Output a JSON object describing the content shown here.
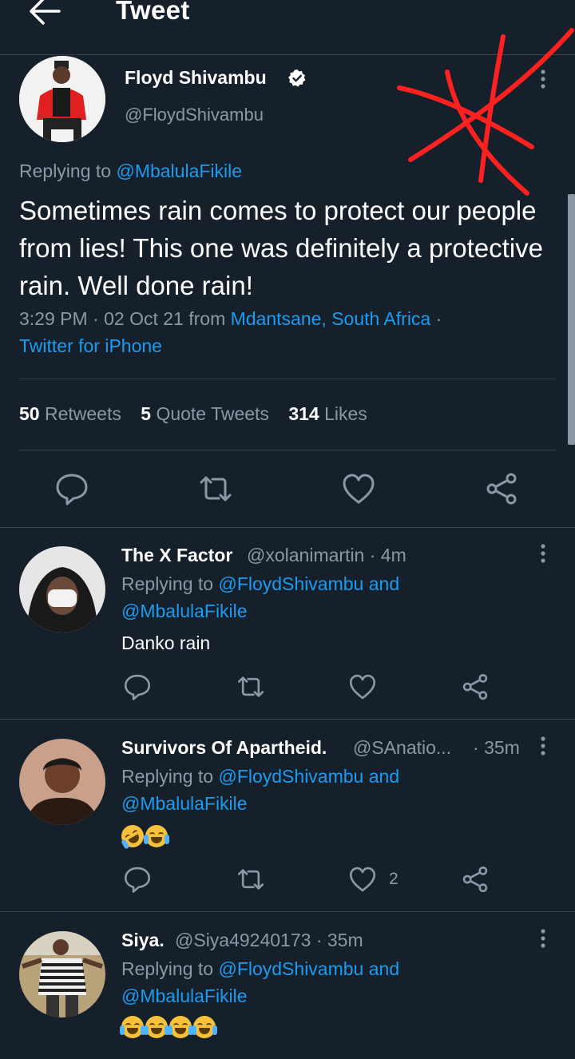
{
  "header": {
    "title": "Tweet"
  },
  "tweet": {
    "author_name": "Floyd Shivambu",
    "author_handle": "@FloydShivambu",
    "replying_prefix": "Replying to",
    "replying_to": "@MbalulaFikile",
    "text": "Sometimes rain comes to protect our people from lies! This one was definitely a protective rain. Well done rain!",
    "time": "3:29 PM",
    "date": "02 Oct 21",
    "from_word": "from",
    "location": "Mdantsane, South Africa",
    "source": "Twitter for iPhone",
    "stats": {
      "retweets_count": "50",
      "retweets_label": "Retweets",
      "quotes_count": "5",
      "quotes_label": "Quote Tweets",
      "likes_count": "314",
      "likes_label": "Likes"
    }
  },
  "replies": [
    {
      "name": "The X Factor",
      "handle": "@xolanimartin",
      "time": "4m",
      "replying_prefix": "Replying to",
      "replying_to_1": "@FloydShivambu",
      "and": "and",
      "replying_to_2": "@MbalulaFikile",
      "text": "Danko rain",
      "likes": ""
    },
    {
      "name": "Survivors Of Apartheid.",
      "handle": "@SAnatio...",
      "time": "35m",
      "replying_prefix": "Replying to",
      "replying_to_1": "@FloydShivambu",
      "and": "and",
      "replying_to_2": "@MbalulaFikile",
      "text": "🤣😂",
      "likes": "2"
    },
    {
      "name": "Siya.",
      "handle": "@Siya49240173",
      "time": "35m",
      "replying_prefix": "Replying to",
      "replying_to_1": "@FloydShivambu",
      "and": "and",
      "replying_to_2": "@MbalulaFikile",
      "text": "😂😂😂😂",
      "likes": ""
    }
  ],
  "colors": {
    "background": "#15202b",
    "accent": "#1d9bf0",
    "muted": "#8b98a5",
    "divider": "#38444d",
    "annotation": "#ff2020"
  },
  "icons": [
    "back-arrow-icon",
    "verified-badge-icon",
    "more-options-icon",
    "reply-icon",
    "retweet-icon",
    "like-icon",
    "share-icon"
  ]
}
